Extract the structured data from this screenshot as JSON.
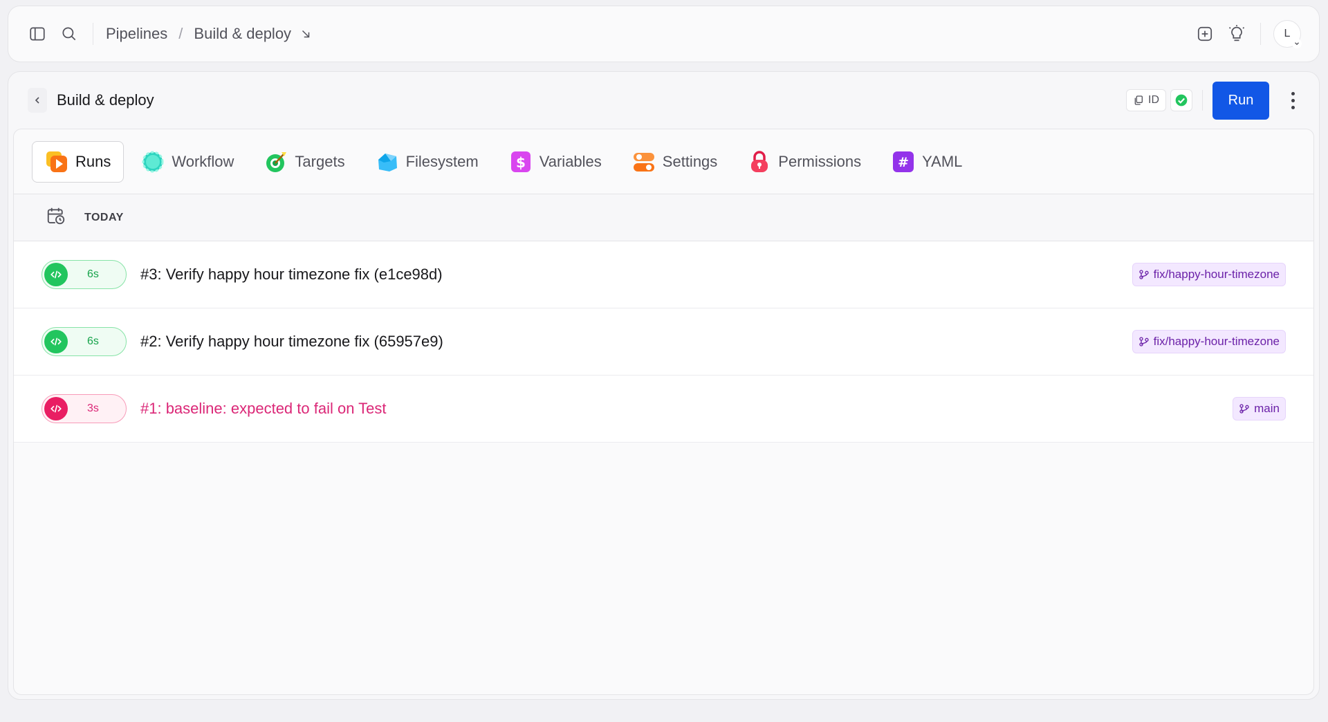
{
  "topbar": {
    "breadcrumb_root": "Pipelines",
    "breadcrumb_separator": "/",
    "breadcrumb_current": "Build & deploy",
    "avatar_initial": "L"
  },
  "header": {
    "title": "Build & deploy",
    "id_label": "ID",
    "run_label": "Run",
    "accent_color": "#1257e6"
  },
  "tabs": [
    {
      "label": "Runs",
      "icon": "runs-icon",
      "active": true
    },
    {
      "label": "Workflow",
      "icon": "workflow-icon"
    },
    {
      "label": "Targets",
      "icon": "targets-icon"
    },
    {
      "label": "Filesystem",
      "icon": "filesystem-icon"
    },
    {
      "label": "Variables",
      "icon": "variables-icon"
    },
    {
      "label": "Settings",
      "icon": "settings-icon"
    },
    {
      "label": "Permissions",
      "icon": "permissions-icon"
    },
    {
      "label": "YAML",
      "icon": "yaml-icon"
    }
  ],
  "runs": {
    "group_label": "TODAY",
    "items": [
      {
        "status": "success",
        "duration": "6s",
        "title": "#3: Verify happy hour timezone fix (e1ce98d)",
        "branch": "fix/happy-hour-timezone"
      },
      {
        "status": "success",
        "duration": "6s",
        "title": "#2: Verify happy hour timezone fix (65957e9)",
        "branch": "fix/happy-hour-timezone"
      },
      {
        "status": "failed",
        "duration": "3s",
        "title": "#1: baseline: expected to fail on Test",
        "branch": "main"
      }
    ]
  },
  "colors": {
    "success": "#22c55e",
    "failed": "#e91e63",
    "branch_bg": "#f3e8ff"
  }
}
